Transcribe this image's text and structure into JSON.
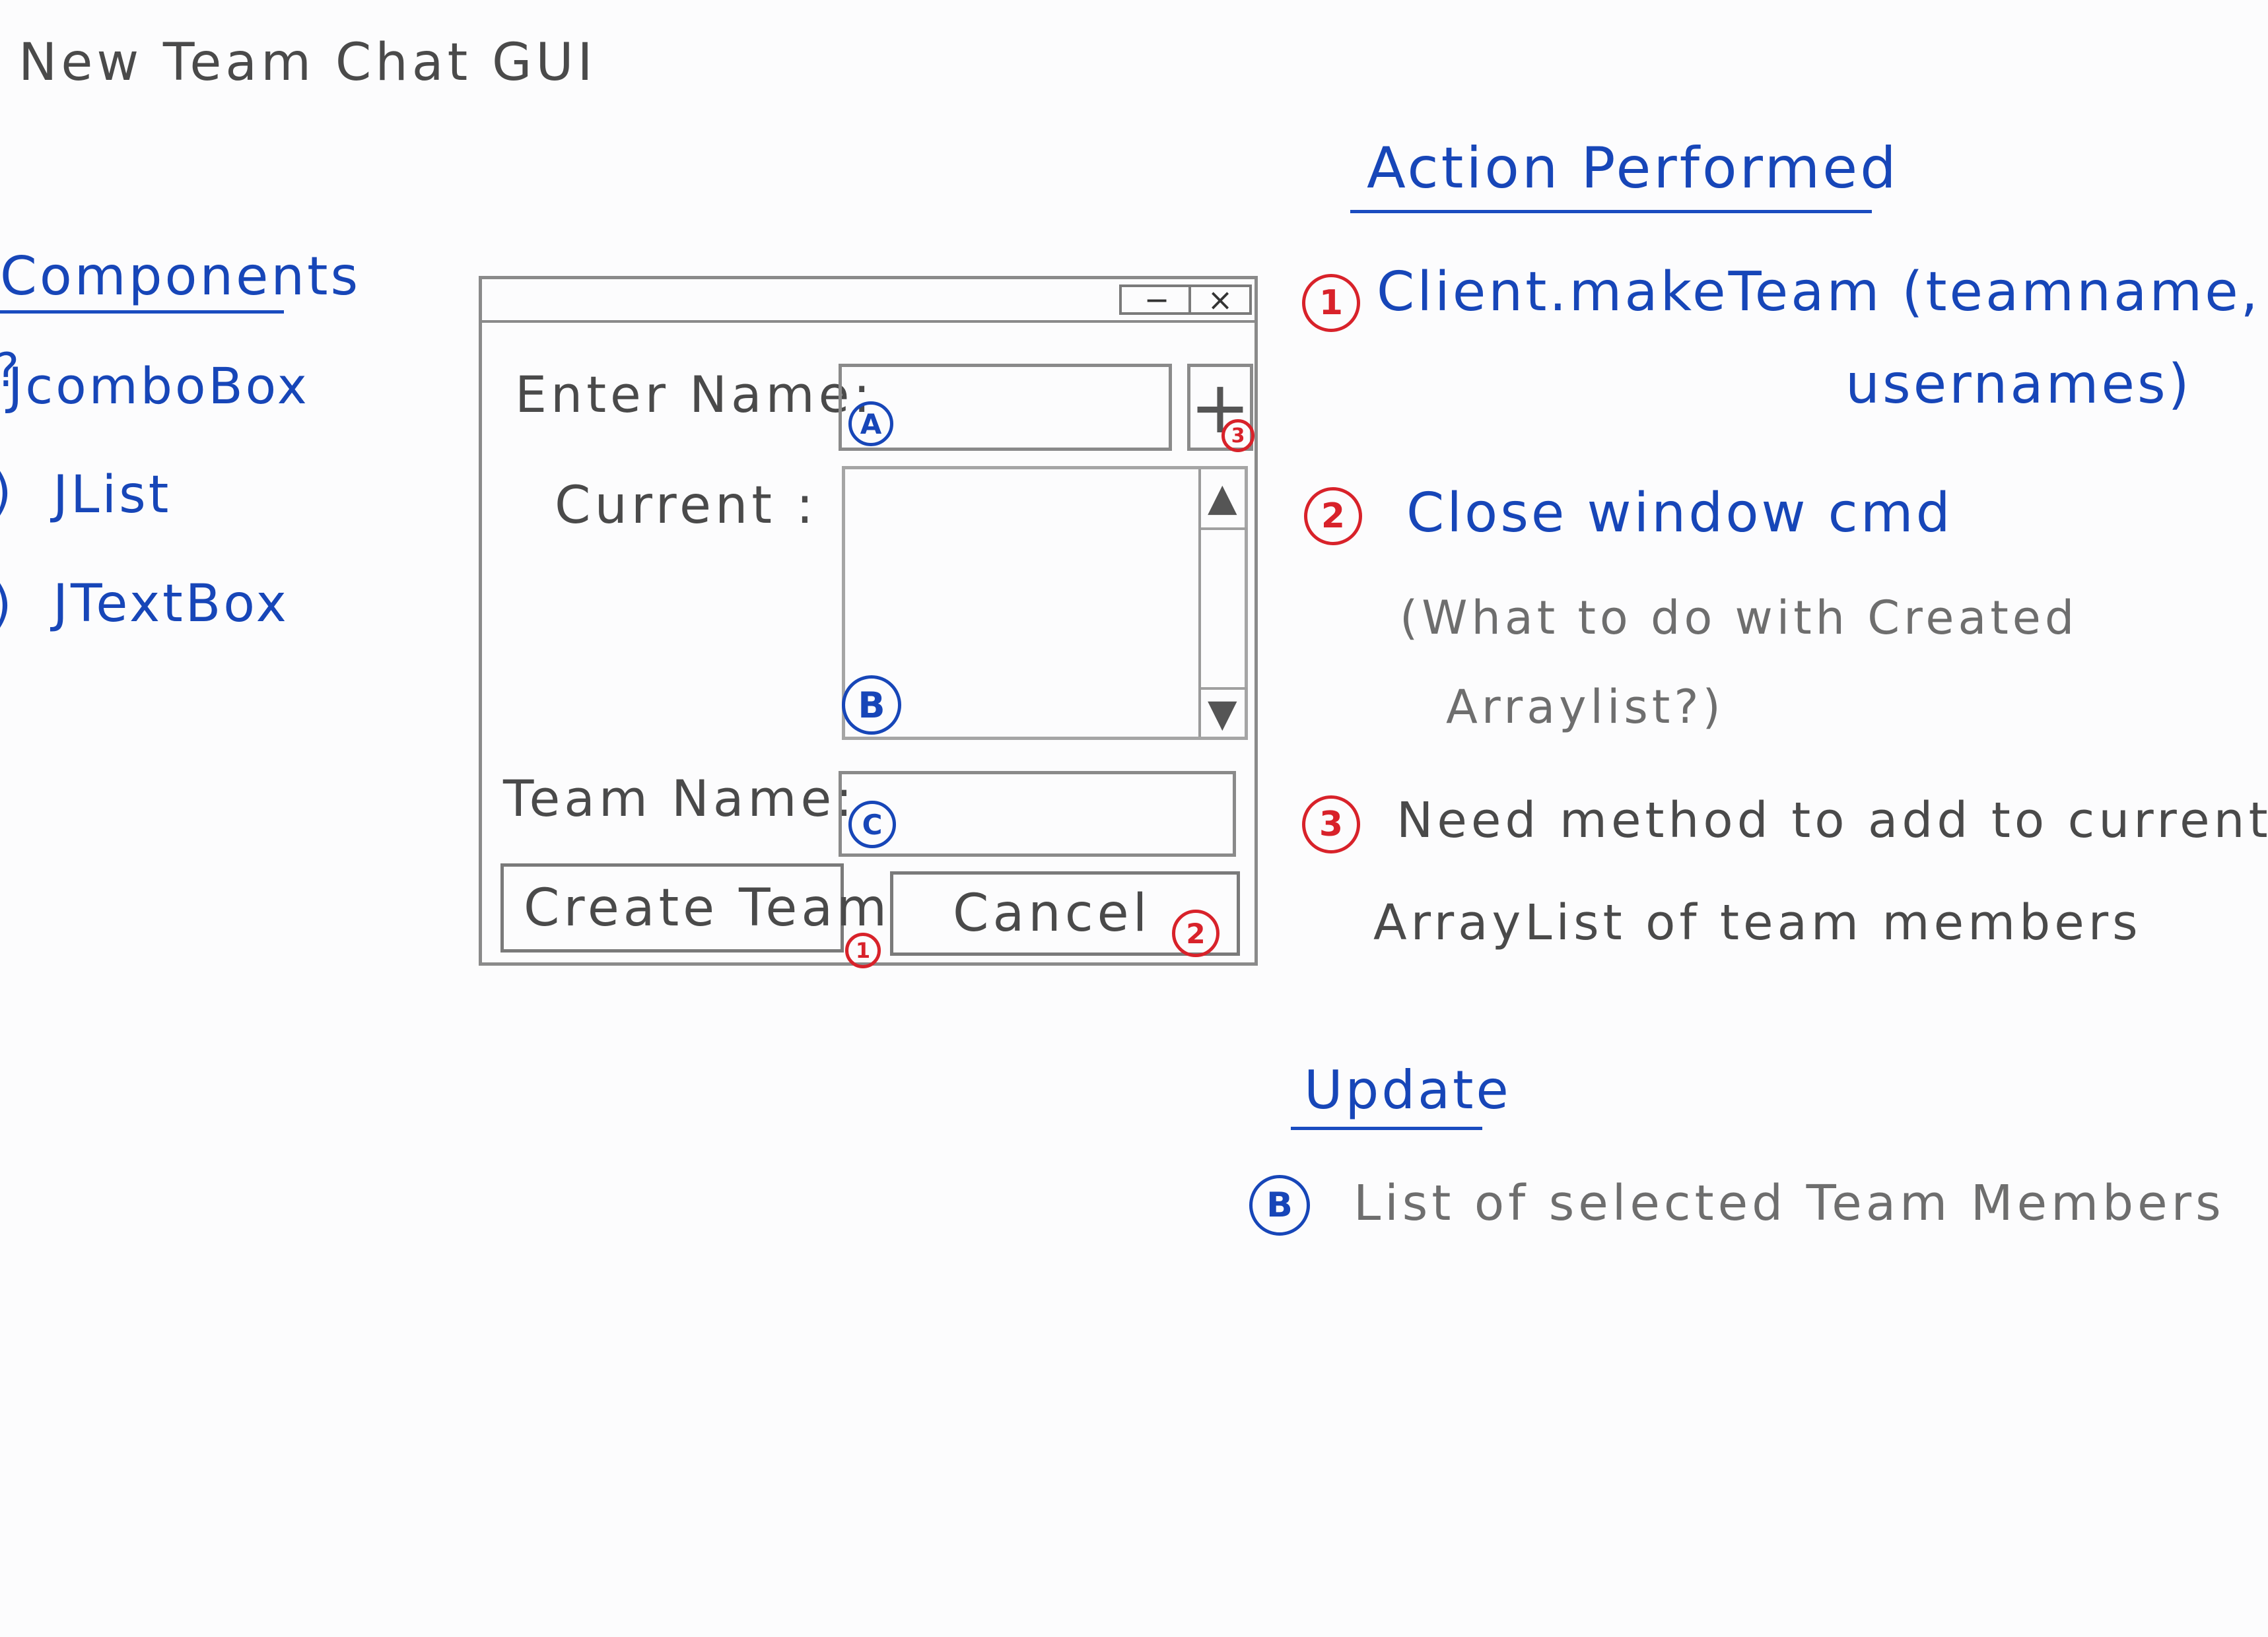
{
  "page_title": "New Team Chat GUI",
  "components": {
    "heading": "Components",
    "items": [
      {
        "marker": "?",
        "label": "JcomboBox"
      },
      {
        "marker": ")",
        "label": "JList"
      },
      {
        "marker": ")",
        "label": "JTextBox"
      }
    ]
  },
  "window": {
    "minimize_glyph": "−",
    "close_glyph": "×",
    "enter_name_label": "Enter Name:",
    "current_label": "Current :",
    "team_name_label": "Team Name:",
    "add_glyph": "+",
    "scroll_up_glyph": "▲",
    "scroll_down_glyph": "▼",
    "create_team_button": "Create Team",
    "cancel_button": "Cancel",
    "marker_a": "A",
    "marker_b": "B",
    "marker_c": "C",
    "marker_1": "1",
    "marker_2": "2",
    "marker_3": "3"
  },
  "actions": {
    "heading": "Action Performed",
    "items": [
      {
        "number": "1",
        "line1": "Client.makeTeam (teamname,",
        "line2": "usernames)"
      },
      {
        "number": "2",
        "line1": "Close window cmd",
        "note1": "(What to do with Created",
        "note2": "Arraylist?)"
      },
      {
        "number": "3",
        "line1": "Need method to add to current",
        "line2": "ArrayList of team members"
      }
    ]
  },
  "update": {
    "heading": "Update",
    "marker": "B",
    "text": "List of selected Team Members"
  },
  "colors": {
    "pencil": "#4a4a4a",
    "blue_ink": "#1746b8",
    "red_ink": "#d8222a",
    "paper": "#fcfcfd"
  }
}
